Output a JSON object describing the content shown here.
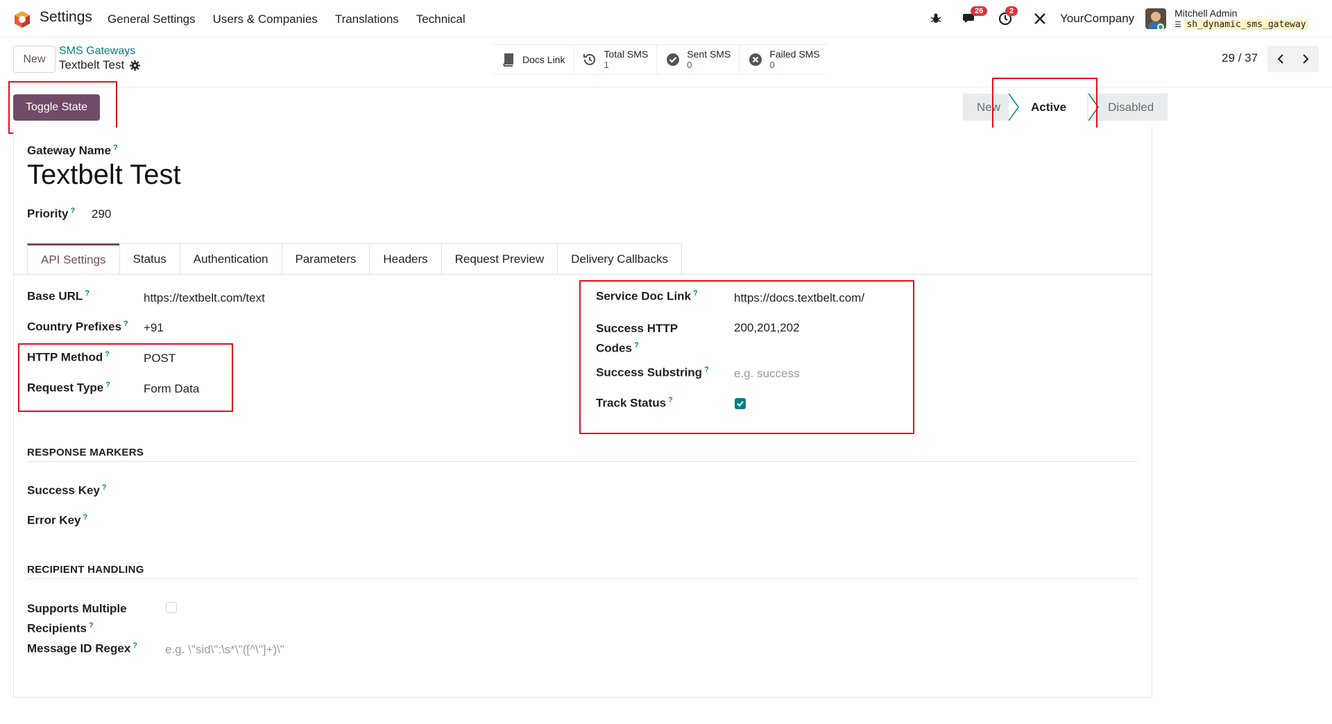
{
  "navbar": {
    "app_name": "Settings",
    "menu": [
      "General Settings",
      "Users & Companies",
      "Translations",
      "Technical"
    ],
    "messages_badge": "26",
    "activities_badge": "2",
    "company": "YourCompany",
    "user_name": "Mitchell Admin",
    "database": "sh_dynamic_sms_gateway"
  },
  "control": {
    "new_label": "New",
    "breadcrumb_parent": "SMS Gateways",
    "breadcrumb_current": "Textbelt Test",
    "smart_buttons": {
      "docs": "Docs Link",
      "total_label": "Total SMS",
      "total_value": "1",
      "sent_label": "Sent SMS",
      "sent_value": "0",
      "failed_label": "Failed SMS",
      "failed_value": "0"
    },
    "pager": "29 / 37"
  },
  "header": {
    "toggle_label": "Toggle State",
    "stages": [
      "New",
      "Active",
      "Disabled"
    ],
    "current_stage": "Active"
  },
  "form": {
    "gateway_name_label": "Gateway Name",
    "gateway_name": "Textbelt Test",
    "priority_label": "Priority",
    "priority": "290",
    "tabs": [
      "API Settings",
      "Status",
      "Authentication",
      "Parameters",
      "Headers",
      "Request Preview",
      "Delivery Callbacks"
    ],
    "active_tab": "API Settings",
    "base_url_label": "Base URL",
    "base_url": "https://textbelt.com/text",
    "country_prefixes_label": "Country Prefixes",
    "country_prefixes": "+91",
    "http_method_label": "HTTP Method",
    "http_method": "POST",
    "request_type_label": "Request Type",
    "request_type": "Form Data",
    "service_doc_label": "Service Doc Link",
    "service_doc": "https://docs.textbelt.com/",
    "success_codes_label_1": "Success HTTP",
    "success_codes_label_2": "Codes",
    "success_codes": "200,201,202",
    "success_substring_label": "Success Substring",
    "success_substring_placeholder": "e.g. success",
    "track_status_label": "Track Status",
    "track_status": true,
    "response_markers_title": "RESPONSE MARKERS",
    "success_key_label": "Success Key",
    "error_key_label": "Error Key",
    "recipient_handling_title": "RECIPIENT HANDLING",
    "multi_recipients_label_1": "Supports Multiple",
    "multi_recipients_label_2": "Recipients",
    "multi_recipients": false,
    "message_id_regex_label": "Message ID Regex",
    "message_id_regex_placeholder": "e.g. \\\"sid\\\":\\s*\\\"([^\\\"]+)\\\""
  },
  "colors": {
    "brand": "#714b67",
    "link": "#017e84",
    "highlight": "#e0101b"
  }
}
